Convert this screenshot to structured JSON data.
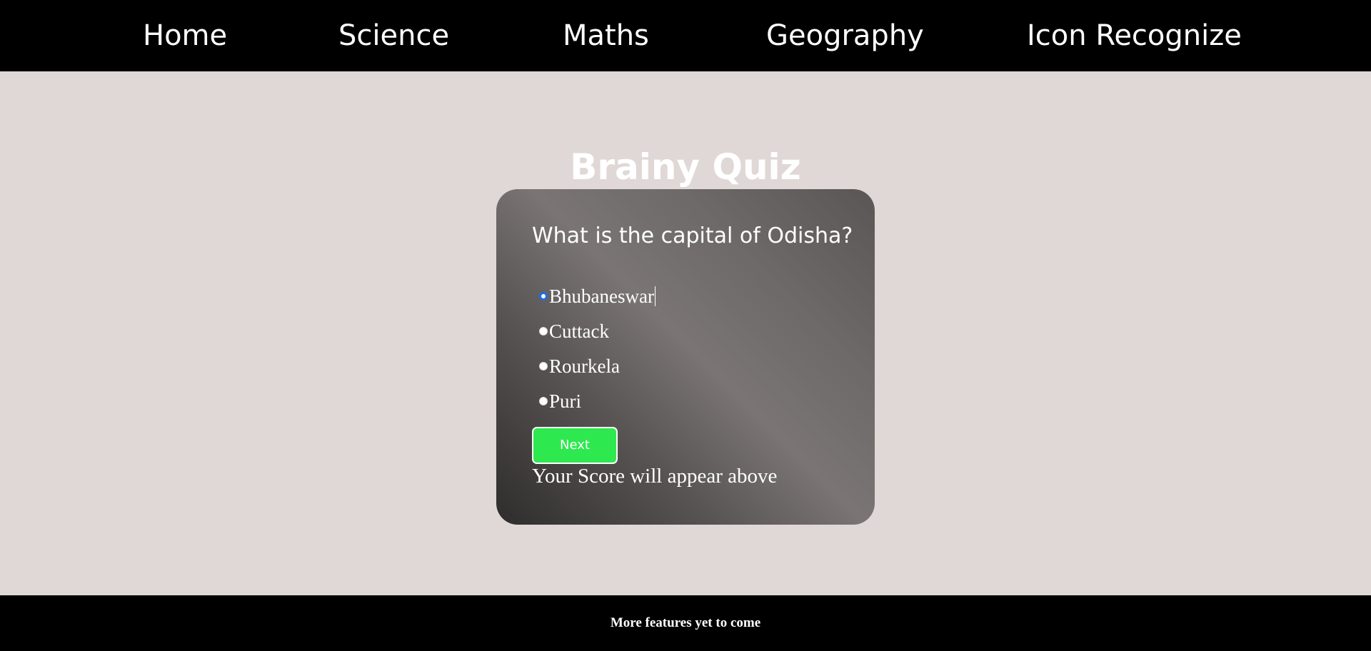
{
  "nav": {
    "items": [
      {
        "label": "Home"
      },
      {
        "label": "Science"
      },
      {
        "label": "Maths"
      },
      {
        "label": "Geography"
      },
      {
        "label": "Icon Recognize"
      }
    ]
  },
  "quiz": {
    "title": "Brainy Quiz",
    "question": "What is the capital of Odisha?",
    "options": [
      {
        "label": "Bhubaneswar",
        "selected": true
      },
      {
        "label": "Cuttack",
        "selected": false
      },
      {
        "label": "Rourkela",
        "selected": false
      },
      {
        "label": "Puri",
        "selected": false
      }
    ],
    "next_label": "Next",
    "score_text": "Your Score will appear above"
  },
  "footer": {
    "text": "More features yet to come"
  },
  "colors": {
    "nav_background": "#000000",
    "page_background": "#e0d8d6",
    "next_button": "#2ee84f",
    "radio_selected": "#1e6fe0"
  }
}
